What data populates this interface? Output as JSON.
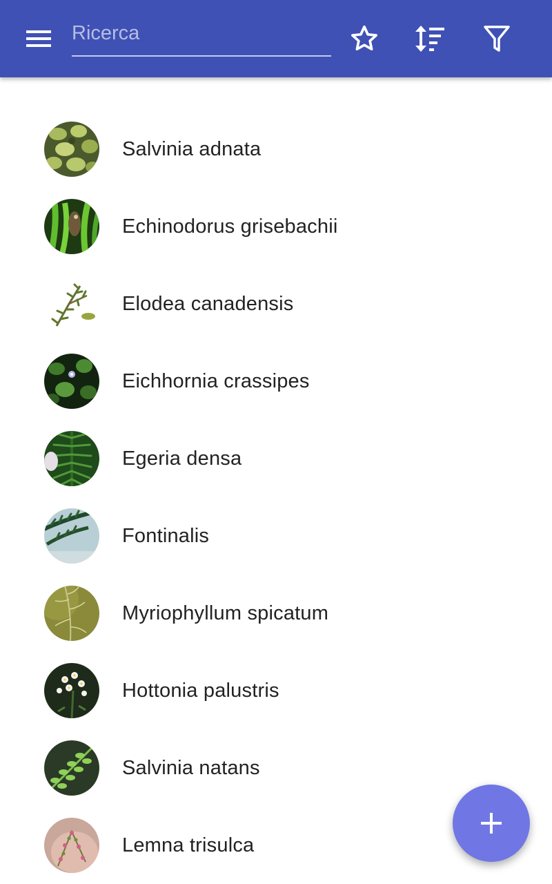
{
  "app_bar": {
    "background_color": "#3f51b5",
    "menu_icon": "hamburger-menu-icon",
    "search": {
      "placeholder": "Ricerca",
      "value": ""
    },
    "actions": [
      {
        "icon": "star-outline-icon"
      },
      {
        "icon": "sort-icon"
      },
      {
        "icon": "filter-icon"
      }
    ]
  },
  "plants": [
    {
      "name": "Salvinia adnata",
      "thumbnail": "floating-leaves-photo"
    },
    {
      "name": "Echinodorus grisebachii",
      "thumbnail": "green-leaves-fish-photo"
    },
    {
      "name": "Elodea canadensis",
      "thumbnail": "sprig-on-white-photo"
    },
    {
      "name": "Eichhornia crassipes",
      "thumbnail": "dark-leaves-flower-photo"
    },
    {
      "name": "Egeria densa",
      "thumbnail": "dense-green-stem-photo"
    },
    {
      "name": "Fontinalis",
      "thumbnail": "moss-strands-photo"
    },
    {
      "name": "Myriophyllum spicatum",
      "thumbnail": "feathery-leaves-photo"
    },
    {
      "name": "Hottonia palustris",
      "thumbnail": "white-flowers-photo"
    },
    {
      "name": "Salvinia natans",
      "thumbnail": "green-leaflets-photo"
    },
    {
      "name": "Lemna trisulca",
      "thumbnail": "pink-sprigs-in-hand-photo"
    }
  ],
  "fab": {
    "icon": "plus-icon",
    "color": "#7077e4"
  }
}
